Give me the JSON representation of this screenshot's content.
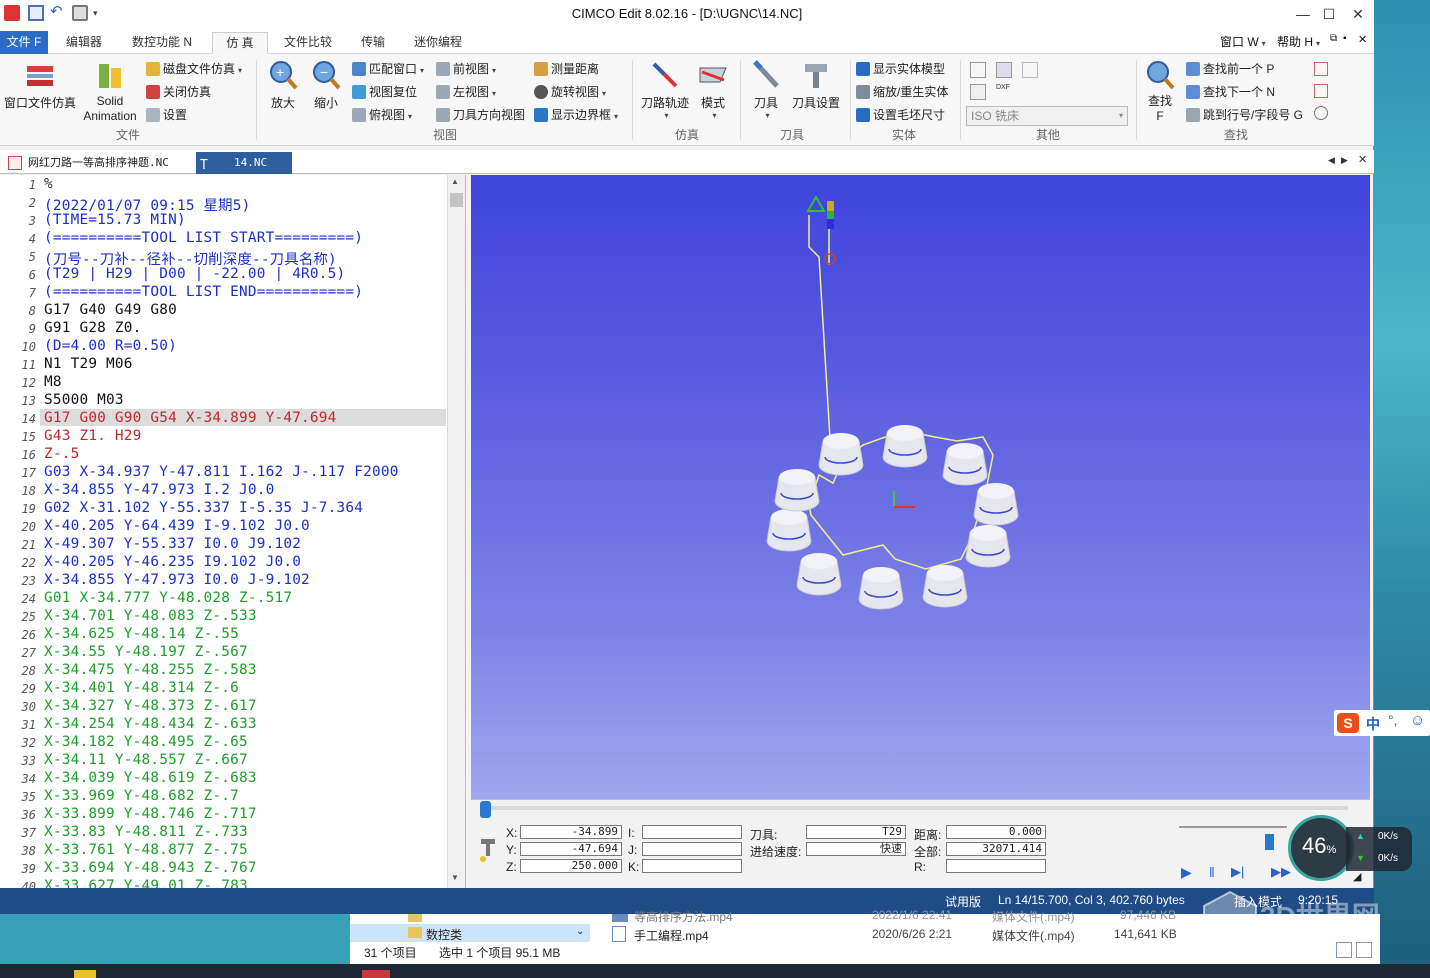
{
  "window": {
    "title": "CIMCO Edit 8.02.16 - [D:\\UGNC\\14.NC]"
  },
  "menu": {
    "tabs": [
      "文件 F",
      "编辑器",
      "数控功能 N",
      "仿 真",
      "文件比较",
      "传输",
      "迷你编程"
    ],
    "right": [
      "窗口 W",
      "帮助 H"
    ]
  },
  "ribbon": {
    "file_group": {
      "label": "文件",
      "big1": "窗口文件仿真",
      "big2_l1": "Solid",
      "big2_l2": "Animation",
      "small": [
        "磁盘文件仿真",
        "关闭仿真",
        "设置"
      ]
    },
    "view_group": {
      "label": "视图",
      "big1": "放大",
      "big2": "缩小",
      "col1": [
        "匹配窗口",
        "视图复位",
        "俯视图"
      ],
      "col2": [
        "前视图",
        "左视图",
        "刀具方向视图"
      ],
      "col3": [
        "测量距离",
        "旋转视图",
        "显示边界框"
      ]
    },
    "sim_group": {
      "label": "仿真",
      "big1": "刀路轨迹",
      "big2": "模式"
    },
    "tool_group": {
      "label": "刀具",
      "big1": "刀具",
      "big2": "刀具设置"
    },
    "solid_group": {
      "label": "实体",
      "items": [
        "显示实体模型",
        "缩放/重生实体",
        "设置毛坯尺寸"
      ]
    },
    "other_group": {
      "label": "其他",
      "select": "ISO 铣床"
    },
    "find_group": {
      "label": "查找",
      "big1": "查找",
      "big1_key": "F",
      "items": [
        "查找前一个 P",
        "查找下一个 N",
        "跳到行号/字段号 G"
      ]
    }
  },
  "doc_tabs": [
    "网红刀路一等高排序神题.NC",
    "14.NC"
  ],
  "editor": {
    "lines": [
      {
        "n": "1",
        "text": "%",
        "color": "#333333"
      },
      {
        "n": "2",
        "text": "(2022/01/07 09:15 星期5)",
        "color": "#1c2fc4"
      },
      {
        "n": "3",
        "text": "(TIME=15.73 MIN)",
        "color": "#1c2fc4"
      },
      {
        "n": "4",
        "text": "(==========TOOL LIST START=========)",
        "color": "#1c2fc4"
      },
      {
        "n": "5",
        "text": "(刀号--刀补--径补--切削深度--刀具名称)",
        "color": "#1c2fc4"
      },
      {
        "n": "6",
        "text": "(T29 | H29 | D00 | -22.00 | 4R0.5)",
        "color": "#1c2fc4"
      },
      {
        "n": "7",
        "text": "(==========TOOL LIST END===========)",
        "color": "#1c2fc4"
      },
      {
        "n": "8",
        "text": "G17 G40 G49 G80",
        "color": "#111111"
      },
      {
        "n": "9",
        "text": "G91 G28 Z0.",
        "color": "#111111"
      },
      {
        "n": "10",
        "text": "(D=4.00 R=0.50)",
        "color": "#1c2fc4"
      },
      {
        "n": "11",
        "text": "N1 T29 M06",
        "color": "#111111"
      },
      {
        "n": "12",
        "text": "M8",
        "color": "#111111"
      },
      {
        "n": "13",
        "text": "S5000 M03",
        "color": "#111111"
      },
      {
        "n": "14",
        "text": "G17 G00 G90 G54 X-34.899 Y-47.694",
        "color": "#c0282c"
      },
      {
        "n": "15",
        "text": "G43 Z1. H29",
        "color": "#c0282c"
      },
      {
        "n": "16",
        "text": "Z-.5",
        "color": "#c0282c"
      },
      {
        "n": "17",
        "text": "G03 X-34.937 Y-47.811 I.162 J-.117 F2000",
        "color": "#1c2fc4"
      },
      {
        "n": "18",
        "text": "X-34.855 Y-47.973 I.2 J0.0",
        "color": "#1c2fc4"
      },
      {
        "n": "19",
        "text": "G02 X-31.102 Y-55.337 I-5.35 J-7.364",
        "color": "#1c2fc4"
      },
      {
        "n": "20",
        "text": "X-40.205 Y-64.439 I-9.102 J0.0",
        "color": "#1c2fc4"
      },
      {
        "n": "21",
        "text": "X-49.307 Y-55.337 I0.0 J9.102",
        "color": "#1c2fc4"
      },
      {
        "n": "22",
        "text": "X-40.205 Y-46.235 I9.102 J0.0",
        "color": "#1c2fc4"
      },
      {
        "n": "23",
        "text": "X-34.855 Y-47.973 I0.0 J-9.102",
        "color": "#1c2fc4"
      },
      {
        "n": "24",
        "text": "G01 X-34.777 Y-48.028 Z-.517",
        "color": "#1e9e2a"
      },
      {
        "n": "25",
        "text": "X-34.701 Y-48.083 Z-.533",
        "color": "#1e9e2a"
      },
      {
        "n": "26",
        "text": "X-34.625 Y-48.14 Z-.55",
        "color": "#1e9e2a"
      },
      {
        "n": "27",
        "text": "X-34.55 Y-48.197 Z-.567",
        "color": "#1e9e2a"
      },
      {
        "n": "28",
        "text": "X-34.475 Y-48.255 Z-.583",
        "color": "#1e9e2a"
      },
      {
        "n": "29",
        "text": "X-34.401 Y-48.314 Z-.6",
        "color": "#1e9e2a"
      },
      {
        "n": "30",
        "text": "X-34.327 Y-48.373 Z-.617",
        "color": "#1e9e2a"
      },
      {
        "n": "31",
        "text": "X-34.254 Y-48.434 Z-.633",
        "color": "#1e9e2a"
      },
      {
        "n": "32",
        "text": "X-34.182 Y-48.495 Z-.65",
        "color": "#1e9e2a"
      },
      {
        "n": "33",
        "text": "X-34.11 Y-48.557 Z-.667",
        "color": "#1e9e2a"
      },
      {
        "n": "34",
        "text": "X-34.039 Y-48.619 Z-.683",
        "color": "#1e9e2a"
      },
      {
        "n": "35",
        "text": "X-33.969 Y-48.682 Z-.7",
        "color": "#1e9e2a"
      },
      {
        "n": "36",
        "text": "X-33.899 Y-48.746 Z-.717",
        "color": "#1e9e2a"
      },
      {
        "n": "37",
        "text": "X-33.83 Y-48.811 Z-.733",
        "color": "#1e9e2a"
      },
      {
        "n": "38",
        "text": "X-33.761 Y-48.877 Z-.75",
        "color": "#1e9e2a"
      },
      {
        "n": "39",
        "text": "X-33.694 Y-48.943 Z-.767",
        "color": "#1e9e2a"
      },
      {
        "n": "40",
        "text": "X-33.627 Y-49.01 Z-.783",
        "color": "#1e9e2a"
      }
    ]
  },
  "sim_panel": {
    "x_label": "X:",
    "x_val": "-34.899",
    "y_label": "Y:",
    "y_val": "-47.694",
    "z_label": "Z:",
    "z_val": "250.000",
    "i_label": "I:",
    "j_label": "J:",
    "k_label": "K:",
    "tool_label": "刀具:",
    "tool_val": "T29",
    "feed_label": "进给速度:",
    "feed_val": "快速",
    "dist_label": "距离:",
    "dist_val": "0.000",
    "total_label": "全部:",
    "total_val": "32071.414",
    "r_label": "R:"
  },
  "status": {
    "trial": "试用版",
    "pos": "Ln 14/15.700, Col 3, 402.760 bytes",
    "mode": "插入模式",
    "time": "9:20:15"
  },
  "explorer": {
    "folder": "数控类",
    "count": "31 个项目",
    "selected": "选中 1 个项目  95.1 MB",
    "file1": "等高排序方法.mp4",
    "file2": "手工编程.mp4",
    "date1": "2022/1/6 22:41",
    "date2": "2020/6/26 2:21",
    "type1": "媒体文件(.mp4)",
    "type2": "媒体文件(.mp4)",
    "size1": "97,446 KB",
    "size2": "141,641 KB"
  },
  "net_meter": {
    "percent": "46",
    "unit": "%",
    "up": "0K/s",
    "down": "0K/s"
  },
  "ime": {
    "label": "中"
  },
  "watermark": "3D世界网"
}
